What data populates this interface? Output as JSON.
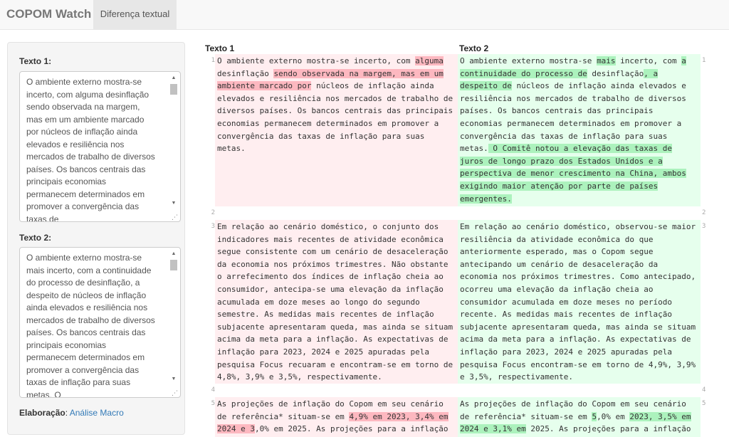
{
  "navbar": {
    "brand": "COPOM Watch",
    "tab": "Diferença textual"
  },
  "sidebar": {
    "label1": "Texto 1:",
    "text1": "O ambiente externo mostra-se incerto, com alguma desinflação sendo observada na margem, mas em um ambiente marcado por núcleos de inflação ainda elevados e resiliência nos mercados de trabalho de diversos países. Os bancos centrais das principais economias permanecem determinados em promover a convergência das taxas de",
    "label2": "Texto 2:",
    "text2": "O ambiente externo mostra-se mais incerto, com a continuidade do processo de desinflação, a despeito de núcleos de inflação ainda elevados e resiliência nos mercados de trabalho de diversos países. Os bancos centrais das principais economias permanecem determinados em promover a convergência das taxas de inflação para suas metas. O",
    "elaboracao_label": "Elaboração",
    "elaboracao_sep": ": ",
    "elaboracao_link": "Análise Macro"
  },
  "diff": {
    "header_left": "Texto 1",
    "header_right": "Texto 2",
    "rows": [
      {
        "n": "1",
        "left": [
          [
            "O ambiente externo mostra-se incerto, com ",
            false
          ],
          [
            "alguma",
            true
          ],
          [
            " desinflação ",
            false
          ],
          [
            "sendo observada na margem, mas em um ambiente marcado por",
            true
          ],
          [
            " núcleos de inflação ainda elevados e resiliência nos mercados de trabalho de diversos países. Os bancos centrais das principais economias permanecem determinados em promover a convergência das taxas de inflação para suas metas.",
            false
          ]
        ],
        "right": [
          [
            "O ambiente externo mostra-se ",
            false
          ],
          [
            "mais",
            true
          ],
          [
            " incerto, com ",
            false
          ],
          [
            "a continuidade do processo de",
            true
          ],
          [
            " desinflação",
            false
          ],
          [
            ", a despeito de",
            true
          ],
          [
            " núcleos de inflação ainda elevados e resiliência nos mercados de trabalho de diversos países. Os bancos centrais das principais economias permanecem determinados em promover a convergência das taxas de inflação para suas metas.",
            false
          ],
          [
            " O Comitê notou a elevação das taxas de juros de longo prazo dos Estados Unidos e a perspectiva de menor crescimento na China, ambos exigindo maior atenção por parte de países emergentes.",
            true
          ]
        ]
      },
      {
        "n": "2",
        "left": [],
        "right": []
      },
      {
        "n": "3",
        "left": [
          [
            "Em relação ao cenário doméstico, o conjunto dos indicadores mais recentes de atividade econômica segue consistente com um cenário de desaceleração da economia nos próximos trimestres. Não obstante o arrefecimento dos índices de inflação cheia ao consumidor, antecipa-se uma elevação da inflação acumulada em doze meses ao longo do segundo semestre. As medidas mais recentes de inflação subjacente apresentaram queda, mas ainda se situam acima da meta para a inflação. As expectativas de inflação para 2023, 2024 e 2025 apuradas pela pesquisa Focus recuaram e encontram-se em torno de 4,8%, 3,9% e 3,5%, respectivamente.",
            false
          ]
        ],
        "right": [
          [
            "Em relação ao cenário doméstico, observou-se maior resiliência da atividade econômica do que anteriormente esperado, mas o Copom segue antecipando um cenário de desaceleração da economia nos próximos trimestres. Como antecipado, ocorreu uma elevação da inflação cheia ao consumidor acumulada em doze meses no período recente. As medidas mais recentes de inflação subjacente apresentaram queda, mas ainda se situam acima da meta para a inflação. As expectativas de inflação para 2023, 2024 e 2025 apuradas pela pesquisa Focus encontram-se em torno de 4,9%, 3,9% e 3,5%, respectivamente.",
            false
          ]
        ]
      },
      {
        "n": "4",
        "left": [],
        "right": []
      },
      {
        "n": "5",
        "left": [
          [
            "As projeções de inflação do Copom em seu cenário de referência* situam-se em ",
            false
          ],
          [
            "4,9% em 2023, 3,4% em 2024 e 3",
            true
          ],
          [
            ",0% em 2025. As projeções para a inflação",
            false
          ]
        ],
        "right": [
          [
            "As projeções de inflação do Copom em seu cenário de referência* situam-se em ",
            false
          ],
          [
            "5",
            true
          ],
          [
            ",0% em ",
            false
          ],
          [
            "2023, 3,5% em 2024 e 3,1% em",
            true
          ],
          [
            " 2025. As projeções para a inflação",
            false
          ]
        ]
      }
    ]
  },
  "colors": {
    "deleted_bg": "#ffeef0",
    "deleted_highlight": "#fdb8c0",
    "inserted_bg": "#e6ffed",
    "inserted_highlight": "#acf2bd",
    "link": "#337ab7"
  }
}
